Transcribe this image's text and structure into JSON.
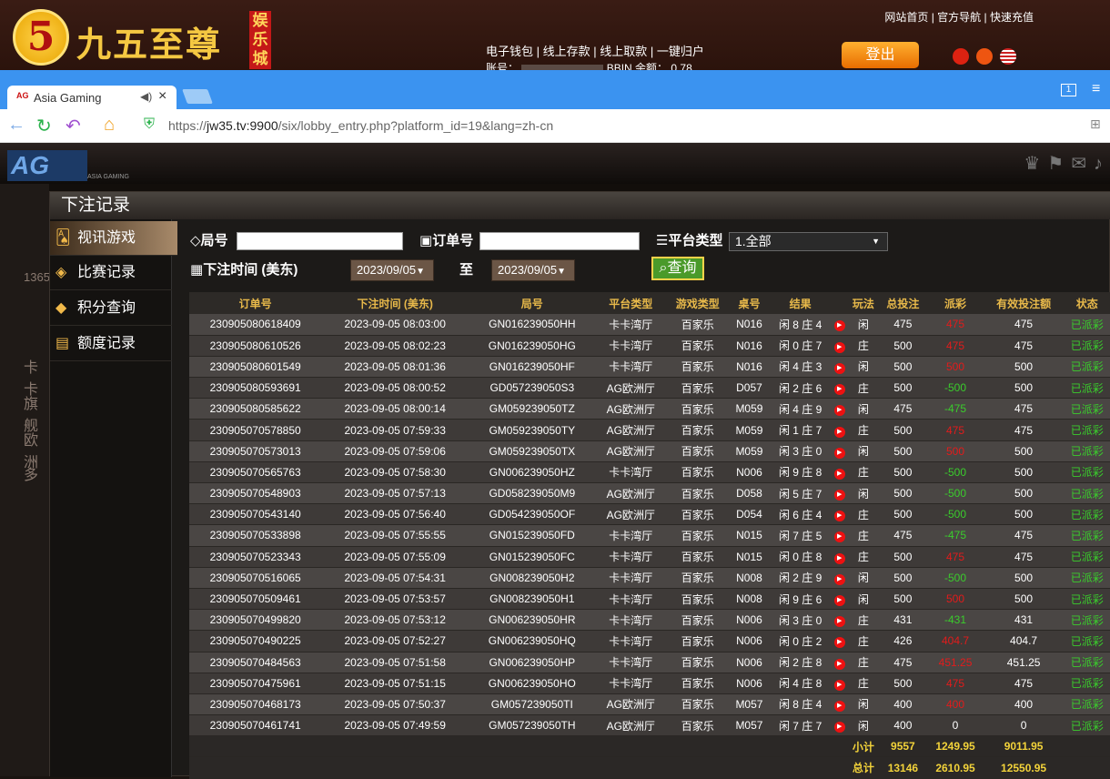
{
  "site": {
    "logo_number": "5",
    "logo_text": "九五至尊",
    "logo_sub": "娱乐城",
    "top_links": [
      "网站首页",
      "官方导航",
      "快速充值"
    ],
    "wallet_links": [
      "电子钱包",
      "线上存款",
      "线上取款",
      "一键归户"
    ],
    "account_label": "账号：",
    "balance_label": "BBIN 余额：",
    "balance_value": "0.78",
    "logout": "登出"
  },
  "browser": {
    "tab_title": "Asia Gaming",
    "tab_icon": "AG",
    "tab_count": "1",
    "url_prefix": "https://",
    "url_host": "jw35.tv:9900",
    "url_path": "/six/lobby_entry.php?platform_id=19&lang=zh-cn"
  },
  "ag": {
    "logo": "AG",
    "logo_sub": "ASIA GAMING",
    "left_bg_items": [
      "1365",
      "卡卡",
      "旗舰",
      "欧洲",
      "多"
    ],
    "panel_title": "下注记录",
    "side_menu": [
      "视讯游戏",
      "比赛记录",
      "积分查询",
      "额度记录"
    ]
  },
  "filters": {
    "round_label": "局号",
    "order_label": "订单号",
    "platform_label": "平台类型",
    "platform_value": "1.全部",
    "time_label": "下注时间 (美东)",
    "date_from": "2023/09/05",
    "to_label": "至",
    "date_to": "2023/09/05",
    "query": "查询"
  },
  "table": {
    "headers": [
      "订单号",
      "下注时间 (美东)",
      "局号",
      "平台类型",
      "游戏类型",
      "桌号",
      "结果",
      "",
      "玩法",
      "总投注",
      "派彩",
      "有效投注额",
      "状态"
    ],
    "rows": [
      [
        "230905080618409",
        "2023-09-05 08:03:00",
        "GN016239050HH",
        "卡卡湾厅",
        "百家乐",
        "N016",
        "闲 8 庄 4",
        "闲",
        "475",
        "475",
        "475",
        "已派彩",
        "red"
      ],
      [
        "230905080610526",
        "2023-09-05 08:02:23",
        "GN016239050HG",
        "卡卡湾厅",
        "百家乐",
        "N016",
        "闲 0 庄 7",
        "庄",
        "500",
        "475",
        "475",
        "已派彩",
        "red"
      ],
      [
        "230905080601549",
        "2023-09-05 08:01:36",
        "GN016239050HF",
        "卡卡湾厅",
        "百家乐",
        "N016",
        "闲 4 庄 3",
        "闲",
        "500",
        "500",
        "500",
        "已派彩",
        "red"
      ],
      [
        "230905080593691",
        "2023-09-05 08:00:52",
        "GD057239050S3",
        "AG欧洲厅",
        "百家乐",
        "D057",
        "闲 2 庄 6",
        "庄",
        "500",
        "-500",
        "500",
        "已派彩",
        "green"
      ],
      [
        "230905080585622",
        "2023-09-05 08:00:14",
        "GM059239050TZ",
        "AG欧洲厅",
        "百家乐",
        "M059",
        "闲 4 庄 9",
        "闲",
        "475",
        "-475",
        "475",
        "已派彩",
        "green"
      ],
      [
        "230905070578850",
        "2023-09-05 07:59:33",
        "GM059239050TY",
        "AG欧洲厅",
        "百家乐",
        "M059",
        "闲 1 庄 7",
        "庄",
        "500",
        "475",
        "475",
        "已派彩",
        "red"
      ],
      [
        "230905070573013",
        "2023-09-05 07:59:06",
        "GM059239050TX",
        "AG欧洲厅",
        "百家乐",
        "M059",
        "闲 3 庄 0",
        "闲",
        "500",
        "500",
        "500",
        "已派彩",
        "red"
      ],
      [
        "230905070565763",
        "2023-09-05 07:58:30",
        "GN006239050HZ",
        "卡卡湾厅",
        "百家乐",
        "N006",
        "闲 9 庄 8",
        "庄",
        "500",
        "-500",
        "500",
        "已派彩",
        "green"
      ],
      [
        "230905070548903",
        "2023-09-05 07:57:13",
        "GD058239050M9",
        "AG欧洲厅",
        "百家乐",
        "D058",
        "闲 5 庄 7",
        "闲",
        "500",
        "-500",
        "500",
        "已派彩",
        "green"
      ],
      [
        "230905070543140",
        "2023-09-05 07:56:40",
        "GD054239050OF",
        "AG欧洲厅",
        "百家乐",
        "D054",
        "闲 6 庄 4",
        "庄",
        "500",
        "-500",
        "500",
        "已派彩",
        "green"
      ],
      [
        "230905070533898",
        "2023-09-05 07:55:55",
        "GN015239050FD",
        "卡卡湾厅",
        "百家乐",
        "N015",
        "闲 7 庄 5",
        "庄",
        "475",
        "-475",
        "475",
        "已派彩",
        "green"
      ],
      [
        "230905070523343",
        "2023-09-05 07:55:09",
        "GN015239050FC",
        "卡卡湾厅",
        "百家乐",
        "N015",
        "闲 0 庄 8",
        "庄",
        "500",
        "475",
        "475",
        "已派彩",
        "red"
      ],
      [
        "230905070516065",
        "2023-09-05 07:54:31",
        "GN008239050H2",
        "卡卡湾厅",
        "百家乐",
        "N008",
        "闲 2 庄 9",
        "闲",
        "500",
        "-500",
        "500",
        "已派彩",
        "green"
      ],
      [
        "230905070509461",
        "2023-09-05 07:53:57",
        "GN008239050H1",
        "卡卡湾厅",
        "百家乐",
        "N008",
        "闲 9 庄 6",
        "闲",
        "500",
        "500",
        "500",
        "已派彩",
        "red"
      ],
      [
        "230905070499820",
        "2023-09-05 07:53:12",
        "GN006239050HR",
        "卡卡湾厅",
        "百家乐",
        "N006",
        "闲 3 庄 0",
        "庄",
        "431",
        "-431",
        "431",
        "已派彩",
        "green"
      ],
      [
        "230905070490225",
        "2023-09-05 07:52:27",
        "GN006239050HQ",
        "卡卡湾厅",
        "百家乐",
        "N006",
        "闲 0 庄 2",
        "庄",
        "426",
        "404.7",
        "404.7",
        "已派彩",
        "red"
      ],
      [
        "230905070484563",
        "2023-09-05 07:51:58",
        "GN006239050HP",
        "卡卡湾厅",
        "百家乐",
        "N006",
        "闲 2 庄 8",
        "庄",
        "475",
        "451.25",
        "451.25",
        "已派彩",
        "red"
      ],
      [
        "230905070475961",
        "2023-09-05 07:51:15",
        "GN006239050HO",
        "卡卡湾厅",
        "百家乐",
        "N006",
        "闲 4 庄 8",
        "庄",
        "500",
        "475",
        "475",
        "已派彩",
        "red"
      ],
      [
        "230905070468173",
        "2023-09-05 07:50:37",
        "GM057239050TI",
        "AG欧洲厅",
        "百家乐",
        "M057",
        "闲 8 庄 4",
        "闲",
        "400",
        "400",
        "400",
        "已派彩",
        "red"
      ],
      [
        "230905070461741",
        "2023-09-05 07:49:59",
        "GM057239050TH",
        "AG欧洲厅",
        "百家乐",
        "M057",
        "闲 7 庄 7",
        "闲",
        "400",
        "0",
        "0",
        "已派彩",
        "white"
      ]
    ],
    "subtotal": {
      "label": "小计",
      "bet": "9557",
      "payout": "1249.95",
      "valid": "9011.95"
    },
    "total": {
      "label": "总计",
      "bet": "13146",
      "payout": "2610.95",
      "valid": "12550.95"
    }
  }
}
